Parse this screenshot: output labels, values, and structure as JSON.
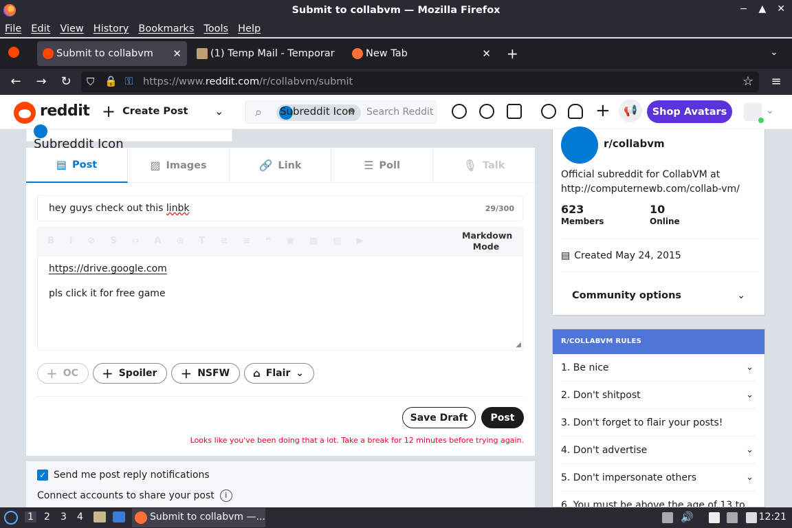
{
  "window": {
    "title": "Submit to collabvm — Mozilla Firefox",
    "controls": [
      "−",
      "▲",
      "✕"
    ]
  },
  "menubar": [
    "File",
    "Edit",
    "View",
    "History",
    "Bookmarks",
    "Tools",
    "Help"
  ],
  "tabs": [
    {
      "label": "Submit to collabvm",
      "active": true
    },
    {
      "label": "(1) Temp Mail - Temporar",
      "active": false
    },
    {
      "label": "New Tab",
      "active": false
    }
  ],
  "urlbar": {
    "prefix": "https://www.",
    "domain": "reddit.com",
    "path": "/r/collabvm/submit"
  },
  "reddit_header": {
    "wordmark": "reddit",
    "create_post": "Create Post",
    "search_chip": "Subreddit Icon",
    "search_placeholder": "Search Reddit",
    "shop_button": "Shop Avatars"
  },
  "compose": {
    "community_picker_text": "Subreddit Icon",
    "tabs": [
      {
        "label": "Post",
        "icon": "document-icon",
        "state": "active"
      },
      {
        "label": "Images",
        "icon": "image-icon",
        "state": "normal"
      },
      {
        "label": "Link",
        "icon": "link-icon",
        "state": "normal"
      },
      {
        "label": "Poll",
        "icon": "poll-icon",
        "state": "normal"
      },
      {
        "label": "Talk",
        "icon": "mic-icon",
        "state": "disabled"
      }
    ],
    "title_prefix": "hey guys check out this ",
    "title_misspelled": "linbk",
    "title_count": "29/300",
    "markdown_mode": "Markdown Mode",
    "body_line1": "https://drive.google.com",
    "body_line2": "pls click it for free game",
    "flags": {
      "oc": "OC",
      "spoiler": "Spoiler",
      "nsfw": "NSFW",
      "flair": "Flair"
    },
    "save_draft": "Save Draft",
    "post": "Post",
    "error": "Looks like you've been doing that a lot. Take a break for 12 minutes before trying again.",
    "notifications_label": "Send me post reply notifications",
    "notifications_checked": true,
    "connect_label": "Connect accounts to share your post"
  },
  "community": {
    "icon_alt": "Subreddit Icon",
    "name": "r/collabvm",
    "description": "Official subreddit for CollabVM at http://computernewb.com/collab-vm/",
    "members_count": "623",
    "members_label": "Members",
    "online_count": "10",
    "online_label": "Online",
    "created": "Created May 24, 2015",
    "options": "Community options"
  },
  "rules": {
    "header": "R/COLLABVM RULES",
    "items": [
      "1. Be nice",
      "2. Don't shitpost",
      "3. Don't forget to flair your posts!",
      "4. Don't advertise",
      "5. Don't impersonate others",
      "6. You must be above the age of 13 to"
    ]
  },
  "taskbar": {
    "workspaces": [
      "1",
      "2",
      "3",
      "4"
    ],
    "app_label": "Submit to collabvm —...",
    "clock": "12:21"
  },
  "colors": {
    "reddit_orange": "#ff4500",
    "reddit_blue": "#0079d3",
    "shop_purple": "#5c32d9",
    "rules_header": "#4f76d6",
    "error_red": "#ea0027"
  }
}
